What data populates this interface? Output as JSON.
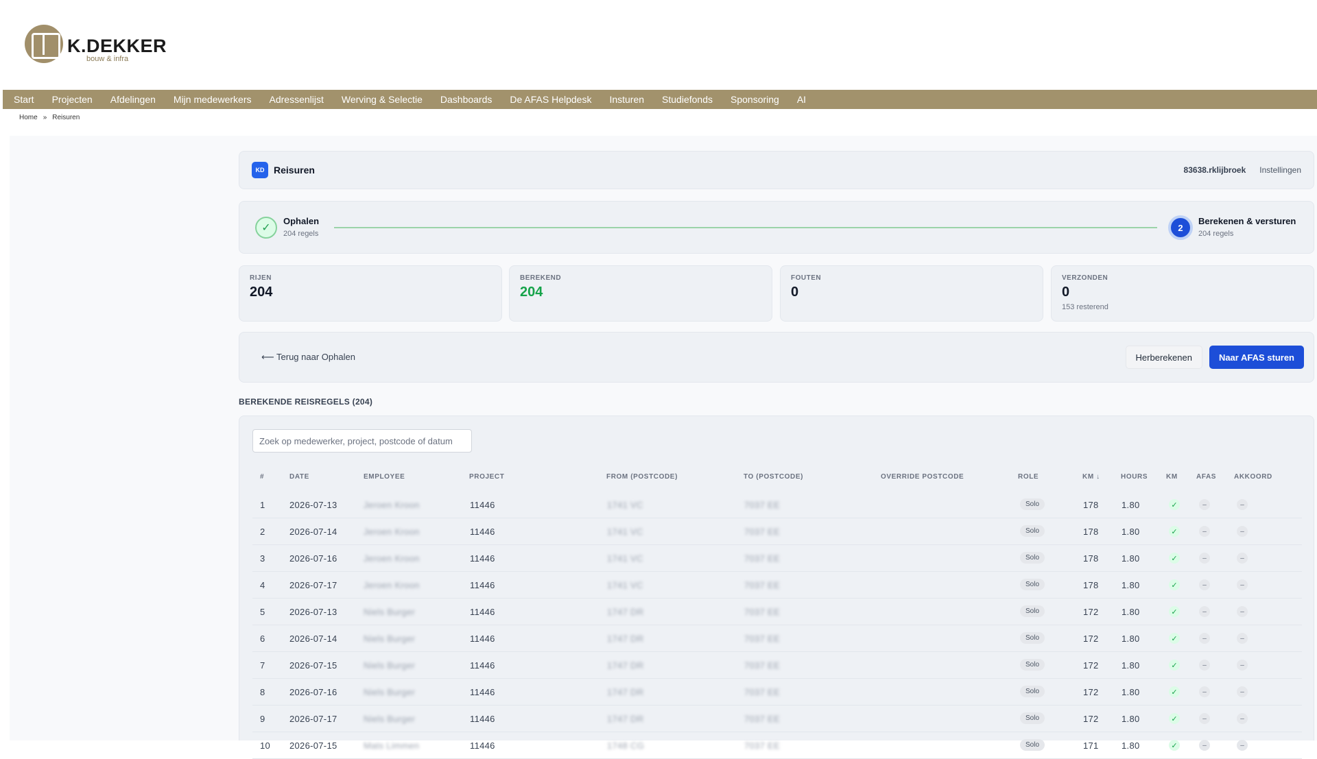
{
  "logo": {
    "name": "K.DEKKER",
    "tagline": "bouw & infra"
  },
  "nav": [
    "Start",
    "Projecten",
    "Afdelingen",
    "Mijn medewerkers",
    "Adressenlijst",
    "Werving & Selectie",
    "Dashboards",
    "De AFAS Helpdesk",
    "Insturen",
    "Studiefonds",
    "Sponsoring",
    "AI"
  ],
  "breadcrumb": {
    "home": "Home",
    "separator": "»",
    "current": "Reisuren"
  },
  "app": {
    "badge": "KD",
    "title": "Reisuren",
    "user": "83638.rklijbroek",
    "settings": "Instellingen"
  },
  "stepper": {
    "step1": {
      "icon": "check-icon",
      "title": "Ophalen",
      "sub": "204 regels"
    },
    "step2": {
      "number": "2",
      "title": "Berekenen & versturen",
      "sub": "204 regels"
    }
  },
  "stats": [
    {
      "label": "RIJEN",
      "value": "204",
      "sub": ""
    },
    {
      "label": "BEREKEND",
      "value": "204",
      "sub": ""
    },
    {
      "label": "FOUTEN",
      "value": "0",
      "sub": ""
    },
    {
      "label": "VERZONDEN",
      "value": "0",
      "sub": "153 resterend"
    }
  ],
  "actions": {
    "back": "⟵ Terug naar Ophalen",
    "recalc": "Herberekenen",
    "send": "Naar AFAS sturen"
  },
  "section_title": "BEREKENDE REISREGELS (204)",
  "search": {
    "placeholder": "Zoek op medewerker, project, postcode of datum"
  },
  "columns": [
    "#",
    "DATE",
    "EMPLOYEE",
    "PROJECT",
    "FROM (POSTCODE)",
    "TO (POSTCODE)",
    "OVERRIDE POSTCODE",
    "ROLE",
    "KM ↓",
    "HOURS",
    "KM",
    "AFAS",
    "AKKOORD"
  ],
  "rows": [
    {
      "num": "1",
      "date": "2026-07-13",
      "employee": "Jeroen Kroon",
      "project": "11446",
      "from": "1741 VC",
      "to": "7037 EE",
      "role": "Solo",
      "km": "178",
      "hours": "1.80"
    },
    {
      "num": "2",
      "date": "2026-07-14",
      "employee": "Jeroen Kroon",
      "project": "11446",
      "from": "1741 VC",
      "to": "7037 EE",
      "role": "Solo",
      "km": "178",
      "hours": "1.80"
    },
    {
      "num": "3",
      "date": "2026-07-16",
      "employee": "Jeroen Kroon",
      "project": "11446",
      "from": "1741 VC",
      "to": "7037 EE",
      "role": "Solo",
      "km": "178",
      "hours": "1.80"
    },
    {
      "num": "4",
      "date": "2026-07-17",
      "employee": "Jeroen Kroon",
      "project": "11446",
      "from": "1741 VC",
      "to": "7037 EE",
      "role": "Solo",
      "km": "178",
      "hours": "1.80"
    },
    {
      "num": "5",
      "date": "2026-07-13",
      "employee": "Niels Burger",
      "project": "11446",
      "from": "1747 DR",
      "to": "7037 EE",
      "role": "Solo",
      "km": "172",
      "hours": "1.80"
    },
    {
      "num": "6",
      "date": "2026-07-14",
      "employee": "Niels Burger",
      "project": "11446",
      "from": "1747 DR",
      "to": "7037 EE",
      "role": "Solo",
      "km": "172",
      "hours": "1.80"
    },
    {
      "num": "7",
      "date": "2026-07-15",
      "employee": "Niels Burger",
      "project": "11446",
      "from": "1747 DR",
      "to": "7037 EE",
      "role": "Solo",
      "km": "172",
      "hours": "1.80"
    },
    {
      "num": "8",
      "date": "2026-07-16",
      "employee": "Niels Burger",
      "project": "11446",
      "from": "1747 DR",
      "to": "7037 EE",
      "role": "Solo",
      "km": "172",
      "hours": "1.80"
    },
    {
      "num": "9",
      "date": "2026-07-17",
      "employee": "Niels Burger",
      "project": "11446",
      "from": "1747 DR",
      "to": "7037 EE",
      "role": "Solo",
      "km": "172",
      "hours": "1.80"
    },
    {
      "num": "10",
      "date": "2026-07-15",
      "employee": "Mats Limmen",
      "project": "11446",
      "from": "1748 CG",
      "to": "7037 EE",
      "role": "Solo",
      "km": "171",
      "hours": "1.80"
    }
  ],
  "status_icons": {
    "km": "✓",
    "afas": "–",
    "akkoord": "–"
  },
  "colors": {
    "brand": "#a2926c",
    "primary": "#1d4ed8",
    "success": "#16a34a"
  }
}
